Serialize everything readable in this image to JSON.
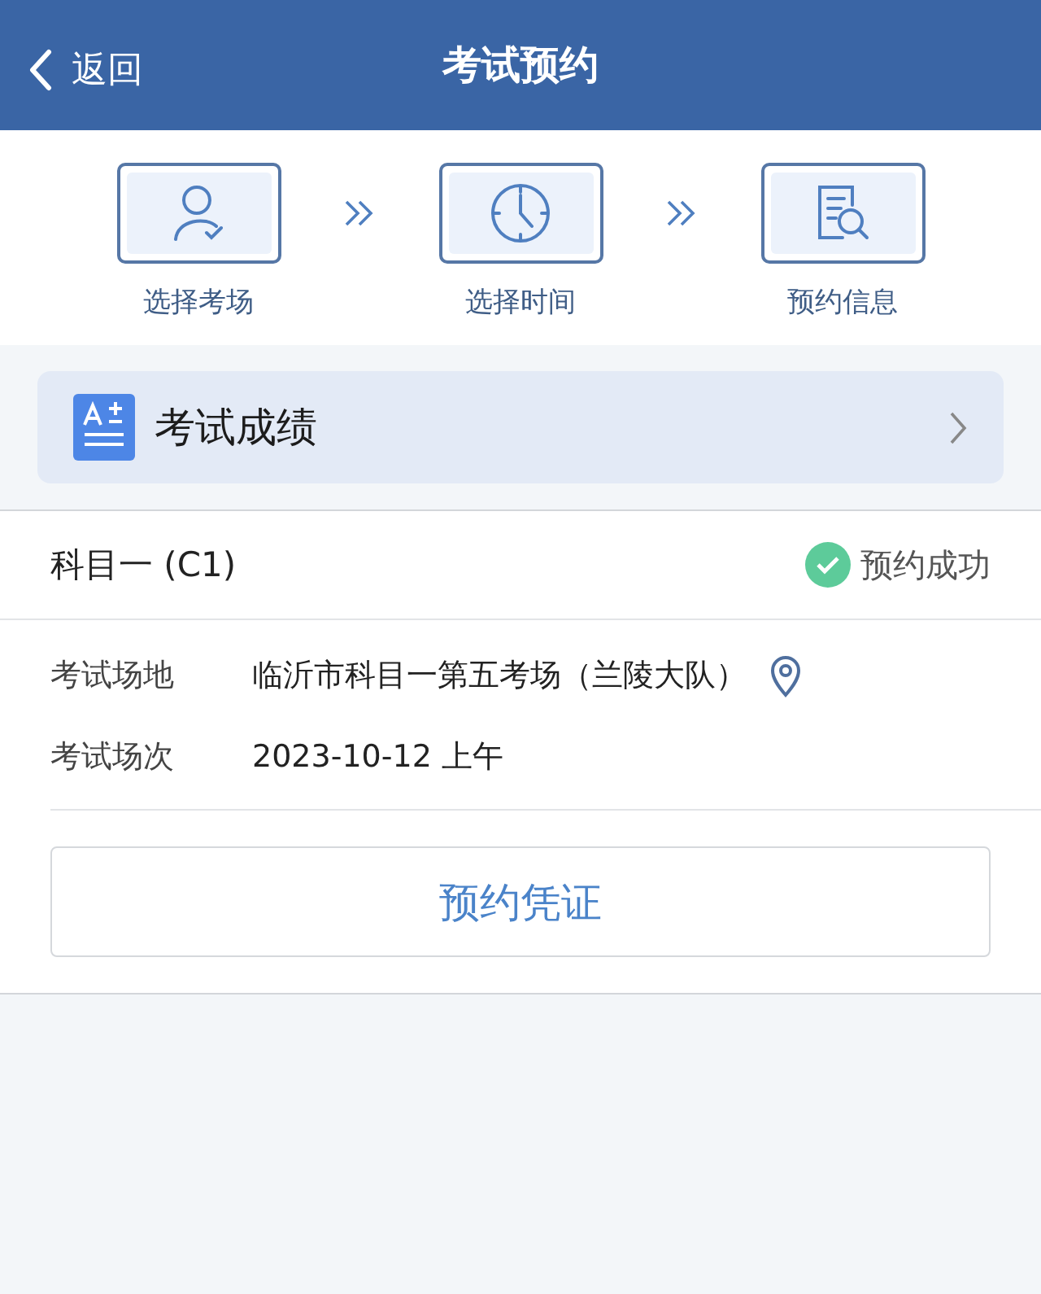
{
  "nav": {
    "back": "返回",
    "title": "考试预约"
  },
  "steps": [
    {
      "kind": "person",
      "label": "选择考场"
    },
    {
      "kind": "clock",
      "label": "选择时间"
    },
    {
      "kind": "document",
      "label": "预约信息"
    }
  ],
  "score_card": {
    "label": "考试成绩"
  },
  "booking": {
    "subject": "科目一 (C1)",
    "status": {
      "kind": "success",
      "label": "预约成功"
    },
    "details": [
      {
        "label": "考试场地",
        "value": "临沂市科目一第五考场（兰陵大队）",
        "kind": "location"
      },
      {
        "label": "考试场次",
        "value": "2023-10-12 上午",
        "kind": "plain"
      }
    ],
    "button": "预约凭证"
  }
}
